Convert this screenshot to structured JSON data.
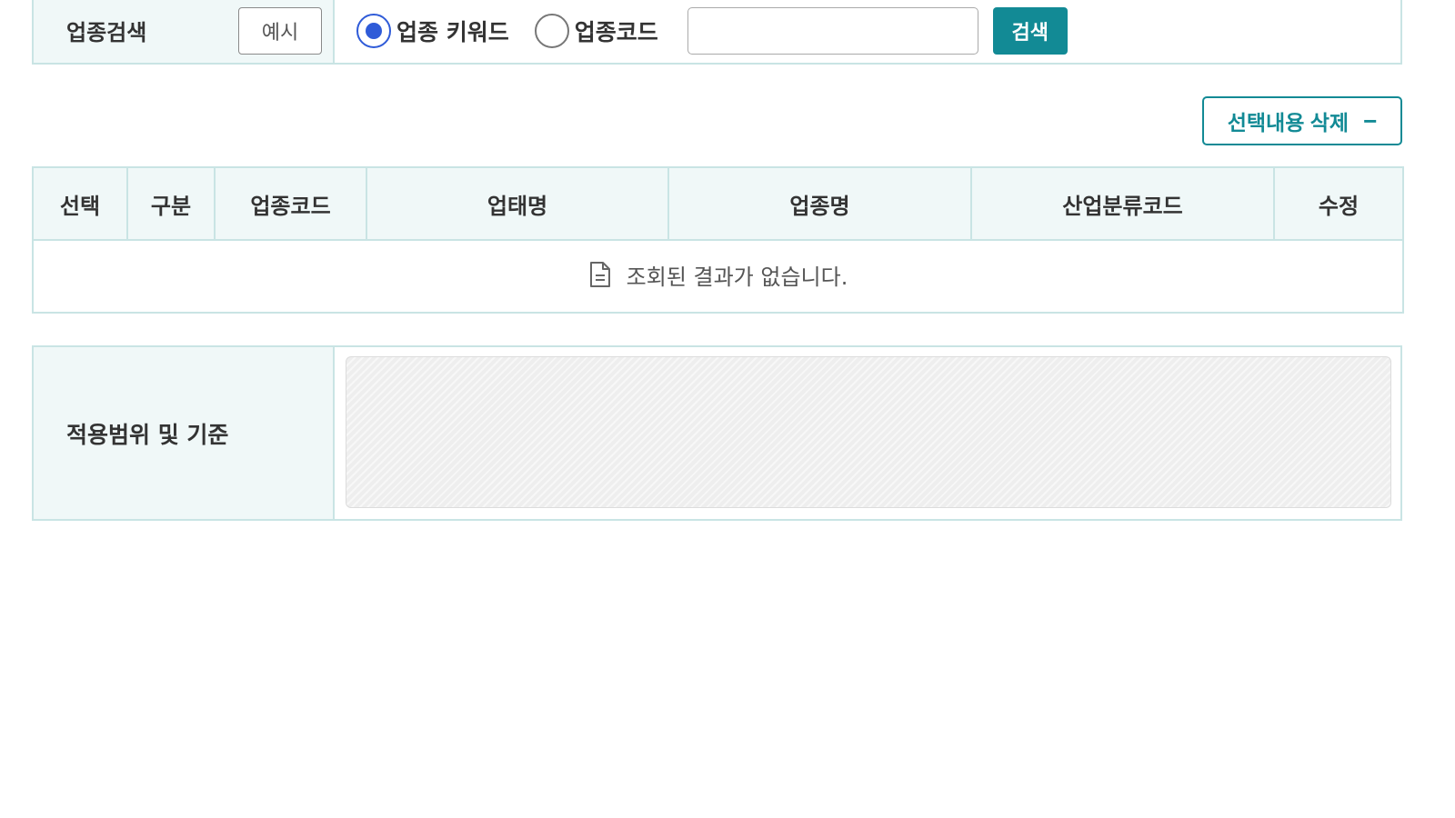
{
  "search": {
    "label": "업종검색",
    "example_button": "예시",
    "radio_options": [
      {
        "label": "업종 키워드",
        "checked": true
      },
      {
        "label": "업종코드",
        "checked": false
      }
    ],
    "input_value": "",
    "input_placeholder": "",
    "search_button": "검색"
  },
  "actions": {
    "delete_selected_label": "선택내용 삭제",
    "delete_selected_symbol": "−"
  },
  "table": {
    "columns": [
      "선택",
      "구분",
      "업종코드",
      "업태명",
      "업종명",
      "산업분류코드",
      "수정"
    ],
    "empty_message": "조회된 결과가 없습니다."
  },
  "scope": {
    "label": "적용범위 및 기준",
    "content": ""
  },
  "colors": {
    "accent": "#128a95",
    "header_bg": "#f0f8f8",
    "border": "#c9e4e4",
    "radio_checked": "#2f5bd8"
  },
  "icons": {
    "empty_result": "document-icon"
  }
}
